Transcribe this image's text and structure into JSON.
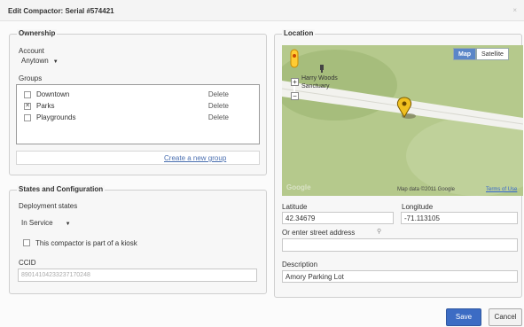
{
  "dialog": {
    "title": "Edit Compactor: Serial #574421"
  },
  "ownership": {
    "legend": "Ownership",
    "account_label": "Account",
    "account_value": "Anytown",
    "groups_label": "Groups",
    "groups": [
      {
        "name": "Downtown",
        "checked": false,
        "delete_label": "Delete"
      },
      {
        "name": "Parks",
        "checked": true,
        "delete_label": "Delete"
      },
      {
        "name": "Playgrounds",
        "checked": false,
        "delete_label": "Delete"
      }
    ],
    "create_group_link": "Create a new group"
  },
  "states": {
    "legend": "States and Configuration",
    "deployment_label": "Deployment states",
    "deployment_value": "In Service",
    "kiosk_label": "This compactor is part of a kiosk",
    "ccid_label": "CCID",
    "ccid_value": "89014104233237170248"
  },
  "location": {
    "legend": "Location",
    "map": {
      "type_active": "Map",
      "type_inactive": "Satellite",
      "place_label_1": "Harry Woods",
      "place_label_2": "Sanctuary",
      "copyright": "Map data ©2011 Google",
      "terms": "Terms of Use",
      "logo": "Google",
      "zoom_in": "+",
      "zoom_out": "−"
    },
    "latitude_label": "Latitude",
    "latitude_value": "42.34679",
    "longitude_label": "Longitude",
    "longitude_value": "-71.113105",
    "street_label": "Or enter street address",
    "description_label": "Description",
    "description_value": "Amory Parking Lot"
  },
  "footer": {
    "save": "Save",
    "cancel": "Cancel"
  },
  "colors": {
    "primary_button": "#3c6cc4",
    "link": "#4a6fb0",
    "map_land": "#b5c98c"
  }
}
